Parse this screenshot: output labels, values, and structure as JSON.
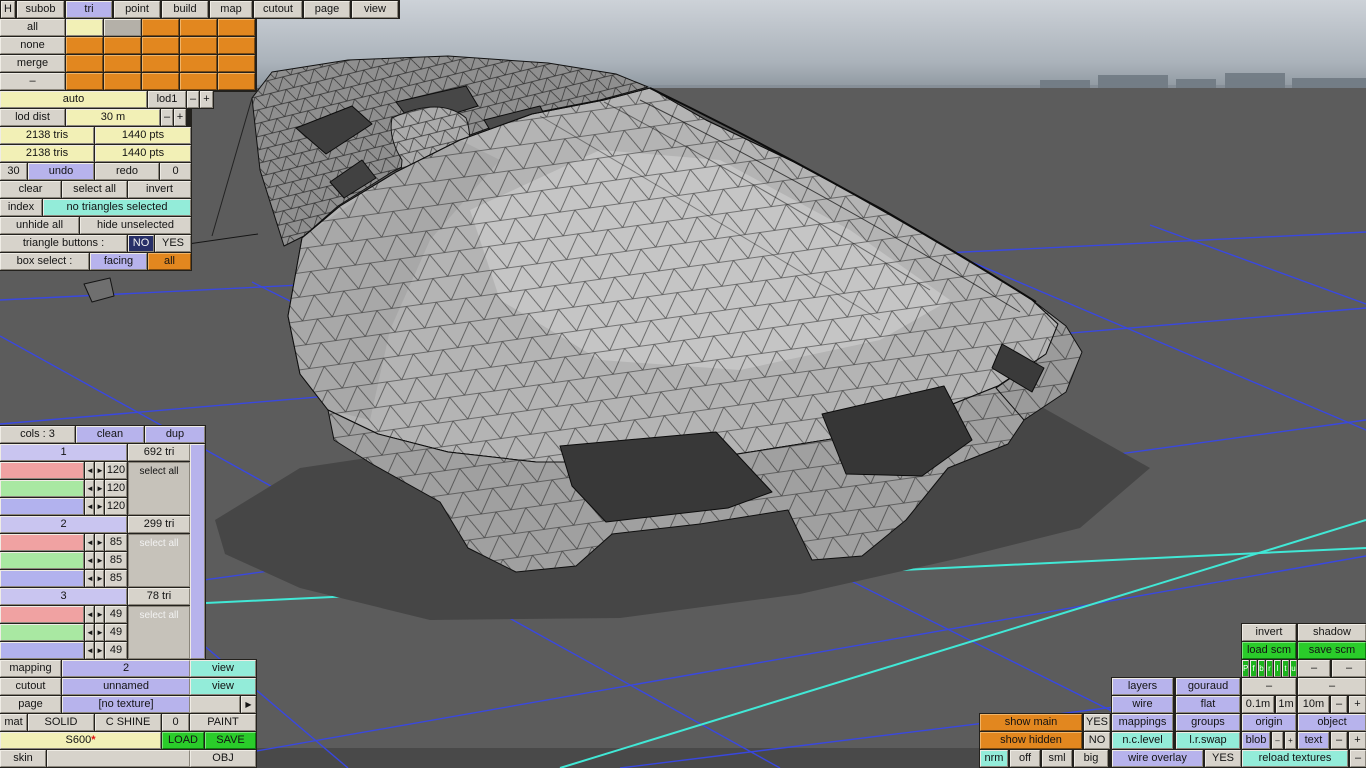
{
  "palette": {
    "orange": "#e2871f",
    "pale_yellow": "#f2f0b6",
    "lavender": "#b7b3ec",
    "aqua": "#93ecd9",
    "green": "#2acc2a",
    "navy": "#272f68",
    "button_grey": "#d7d3cb",
    "grid_blue": "#3847e8",
    "grid_cyan": "#41e8d6",
    "selected_border": "#e03030"
  },
  "menu": {
    "active": "tri",
    "items": [
      {
        "label": "H"
      },
      {
        "label": "subob"
      },
      {
        "label": "tri"
      },
      {
        "label": "point"
      },
      {
        "label": "build"
      },
      {
        "label": "map"
      },
      {
        "label": "cutout"
      },
      {
        "label": "page"
      },
      {
        "label": "view"
      }
    ]
  },
  "subob": {
    "all": "all",
    "none": "none",
    "merge": "merge",
    "dash": "–"
  },
  "lod": {
    "auto": "auto",
    "lod1": "lod1",
    "minus": "–",
    "plus": "+",
    "dist_label": "lod dist",
    "dist_value": "30 m",
    "tris_top": "2138 tris",
    "pts_top": "1440 pts",
    "tris_bottom": "2138 tris",
    "pts_bottom": "1440 pts",
    "undo_steps": "30",
    "undo": "undo",
    "redo": "redo",
    "redo_steps": "0",
    "clear": "clear",
    "select_all": "select all",
    "invert": "invert",
    "index": "index",
    "selection_status": "no triangles selected",
    "unhide_all": "unhide all",
    "hide_unselected": "hide unselected",
    "triangle_buttons_label": "triangle buttons :",
    "triangle_buttons_no": "NO",
    "triangle_buttons_yes": "YES",
    "box_select_label": "box select :",
    "box_select_facing": "facing",
    "box_select_all": "all"
  },
  "groups": {
    "cols": "cols : 3",
    "clean": "clean",
    "dup": "dup",
    "prev": "◄",
    "next": "►",
    "select_all": "select all",
    "list": [
      {
        "id": "1",
        "tris": "692 tri",
        "r": "120",
        "g": "120",
        "b": "120"
      },
      {
        "id": "2",
        "tris": "299 tri",
        "r": "85",
        "g": "85",
        "b": "85"
      },
      {
        "id": "3",
        "tris": "78 tri",
        "r": "49",
        "g": "49",
        "b": "49"
      }
    ]
  },
  "bottom_left": {
    "mapping_label": "mapping",
    "mapping_value": "2",
    "view": "view",
    "cutout_label": "cutout",
    "cutout_value": "unnamed",
    "page_label": "page",
    "page_value": "[no texture]",
    "page_arrow": "▶",
    "mat_label": "mat",
    "mat_solid": "SOLID",
    "mat_cshine": "C SHINE",
    "mat_shine_value": "0",
    "mat_paint": "PAINT",
    "model_name": "S600",
    "modified_star": "*",
    "load": "LOAD",
    "save": "SAVE",
    "skin": "skin",
    "obj": "OBJ"
  },
  "bottom_right": {
    "invert": "invert",
    "shadow": "shadow",
    "load_scm": "load scm",
    "save_scm": "save scm",
    "views": [
      {
        "label": "P"
      },
      {
        "label": "f"
      },
      {
        "label": "b"
      },
      {
        "label": "r"
      },
      {
        "label": "l"
      },
      {
        "label": "t"
      },
      {
        "label": "u"
      }
    ],
    "dash": "–",
    "plus": "+",
    "layers": "layers",
    "gouraud": "gouraud",
    "wire": "wire",
    "flat": "flat",
    "grid_01": "0.1m",
    "grid_1": "1m",
    "grid_10": "10m",
    "show_main": "show main",
    "show_main_value": "YES",
    "mappings": "mappings",
    "groups": "groups",
    "origin": "origin",
    "object": "object",
    "show_hidden": "show hidden",
    "show_hidden_value": "NO",
    "nc_level": "n.c.level",
    "lr_swap": "l.r.swap",
    "blob": "blob",
    "text": "text",
    "nrm": "nrm",
    "off": "off",
    "sml": "sml",
    "big": "big",
    "wire_overlay": "wire overlay",
    "wire_overlay_value": "YES",
    "reload_textures": "reload textures"
  }
}
